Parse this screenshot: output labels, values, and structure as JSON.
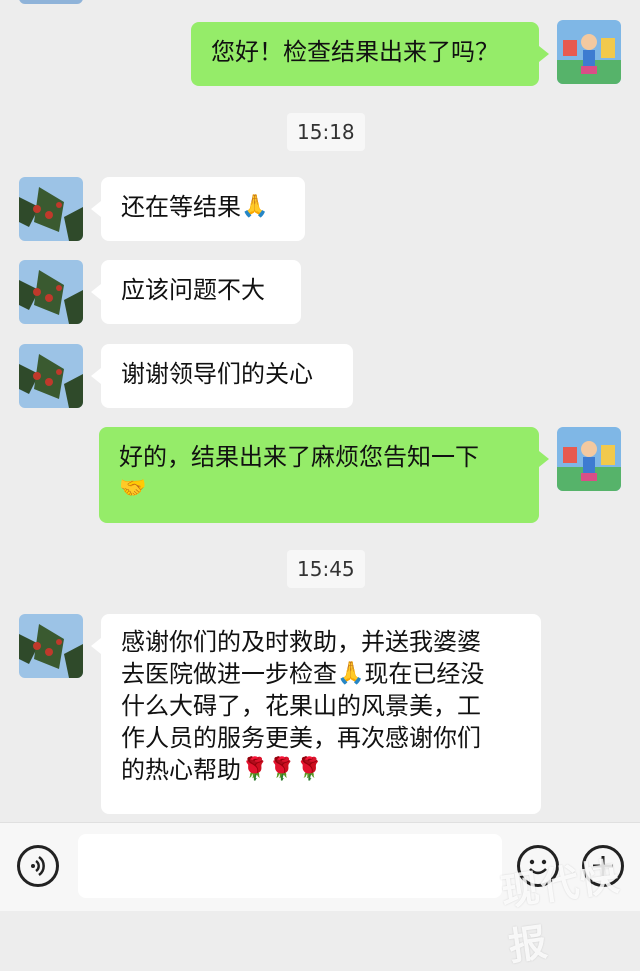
{
  "messages": [
    {
      "text": "您好！检查结果出来了吗？",
      "emoji": ""
    },
    {
      "text": "还在等结果",
      "emoji": "🙏"
    },
    {
      "text": "应该问题不大",
      "emoji": ""
    },
    {
      "text": "谢谢领导们的关心",
      "emoji": ""
    },
    {
      "text": "好的，结果出来了麻烦您告知一下",
      "emoji": "🤝"
    },
    {
      "lines": [
        "感谢你们的及时救助，并送我婆婆",
        "去医院做进一步检查",
        "现在已经没",
        "什么大碍了，花果山的风景美，工",
        "作人员的服务更美，再次感谢你们",
        "的热心帮助"
      ],
      "emoji_mid": "🙏",
      "emoji_end": "🌹🌹🌹"
    }
  ],
  "times": [
    "15:18",
    "15:45"
  ],
  "input": {
    "value": "",
    "voice_icon": "voice-icon",
    "emoji_icon": "emoji-face-icon",
    "plus_icon": "plus-icon"
  },
  "watermark": "现代快报",
  "colors": {
    "background": "#ededed",
    "outgoing_bubble": "#95ec69",
    "incoming_bubble": "#ffffff"
  }
}
